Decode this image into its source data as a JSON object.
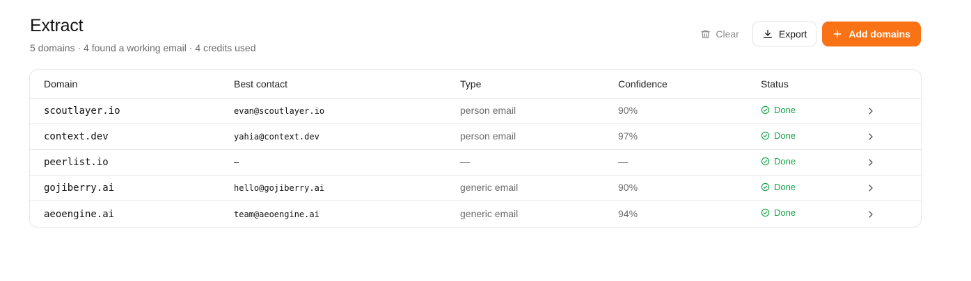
{
  "page": {
    "title": "Extract",
    "subtitle": "5 domains · 4 found a working email · 4 credits used"
  },
  "actions": {
    "clear_label": "Clear",
    "export_label": "Export",
    "add_label": "Add domains"
  },
  "colors": {
    "accent": "#f97316",
    "success": "#16a34a",
    "muted": "#6b6b6b",
    "border": "#e6e6e6"
  },
  "table": {
    "columns": [
      "Domain",
      "Best contact",
      "Type",
      "Confidence",
      "Status"
    ],
    "rows": [
      {
        "domain": "scoutlayer.io",
        "contact": "evan@scoutlayer.io",
        "type": "person email",
        "confidence": "90%",
        "status": "Done"
      },
      {
        "domain": "context.dev",
        "contact": "yahia@context.dev",
        "type": "person email",
        "confidence": "97%",
        "status": "Done"
      },
      {
        "domain": "peerlist.io",
        "contact": "—",
        "type": "—",
        "confidence": "—",
        "status": "Done"
      },
      {
        "domain": "gojiberry.ai",
        "contact": "hello@gojiberry.ai",
        "type": "generic email",
        "confidence": "90%",
        "status": "Done"
      },
      {
        "domain": "aeoengine.ai",
        "contact": "team@aeoengine.ai",
        "type": "generic email",
        "confidence": "94%",
        "status": "Done"
      }
    ]
  },
  "icons": {
    "clear": "trash-icon",
    "export": "download-icon",
    "add": "plus-icon",
    "status": "check-circle-icon",
    "row_action": "chevron-right-icon"
  }
}
